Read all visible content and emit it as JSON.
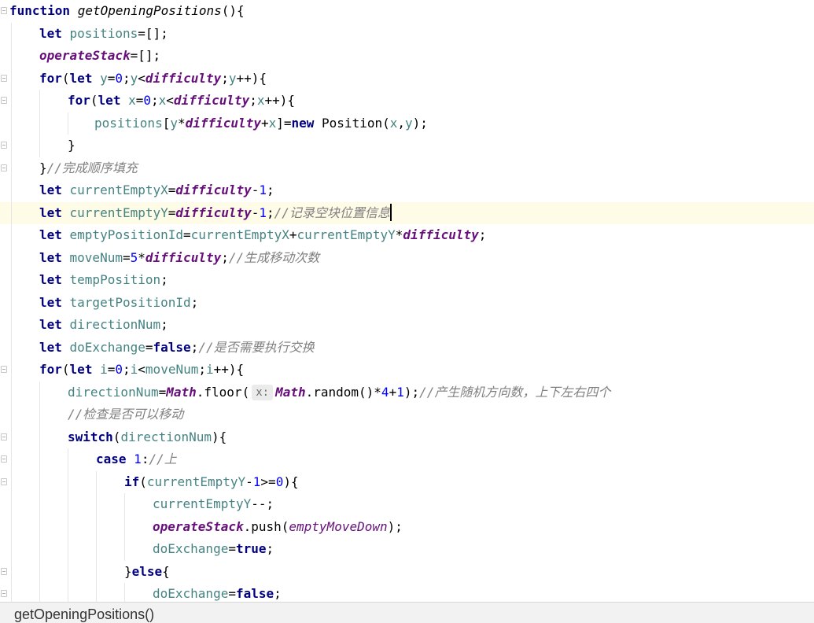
{
  "editor": {
    "lines": [
      {
        "segments": [
          {
            "t": "function ",
            "c": "kw"
          },
          {
            "t": "getOpeningPositions",
            "c": "fn"
          },
          {
            "t": "(){",
            "c": ""
          }
        ]
      },
      {
        "segments": [
          {
            "t": "let ",
            "c": "kw"
          },
          {
            "t": "positions",
            "c": "var"
          },
          {
            "t": "=[];",
            "c": ""
          }
        ]
      },
      {
        "segments": [
          {
            "t": "operateStack",
            "c": "gl"
          },
          {
            "t": "=[];",
            "c": ""
          }
        ]
      },
      {
        "segments": [
          {
            "t": "for",
            "c": "kw"
          },
          {
            "t": "(",
            "c": ""
          },
          {
            "t": "let ",
            "c": "kw"
          },
          {
            "t": "y",
            "c": "var"
          },
          {
            "t": "=",
            "c": ""
          },
          {
            "t": "0",
            "c": "num"
          },
          {
            "t": ";",
            "c": ""
          },
          {
            "t": "y",
            "c": "var"
          },
          {
            "t": "<",
            "c": ""
          },
          {
            "t": "difficulty",
            "c": "gl"
          },
          {
            "t": ";",
            "c": ""
          },
          {
            "t": "y",
            "c": "var"
          },
          {
            "t": "++){",
            "c": ""
          }
        ]
      },
      {
        "segments": [
          {
            "t": "for",
            "c": "kw"
          },
          {
            "t": "(",
            "c": ""
          },
          {
            "t": "let ",
            "c": "kw"
          },
          {
            "t": "x",
            "c": "var"
          },
          {
            "t": "=",
            "c": ""
          },
          {
            "t": "0",
            "c": "num"
          },
          {
            "t": ";",
            "c": ""
          },
          {
            "t": "x",
            "c": "var"
          },
          {
            "t": "<",
            "c": ""
          },
          {
            "t": "difficulty",
            "c": "gl"
          },
          {
            "t": ";",
            "c": ""
          },
          {
            "t": "x",
            "c": "var"
          },
          {
            "t": "++){",
            "c": ""
          }
        ]
      },
      {
        "segments": [
          {
            "t": "positions",
            "c": "var"
          },
          {
            "t": "[",
            "c": ""
          },
          {
            "t": "y",
            "c": "var"
          },
          {
            "t": "*",
            "c": ""
          },
          {
            "t": "difficulty",
            "c": "gl"
          },
          {
            "t": "+",
            "c": ""
          },
          {
            "t": "x",
            "c": "var"
          },
          {
            "t": "]=",
            "c": ""
          },
          {
            "t": "new ",
            "c": "kw"
          },
          {
            "t": "Position(",
            "c": ""
          },
          {
            "t": "x",
            "c": "var"
          },
          {
            "t": ",",
            "c": ""
          },
          {
            "t": "y",
            "c": "var"
          },
          {
            "t": ");",
            "c": ""
          }
        ]
      },
      {
        "segments": [
          {
            "t": "}",
            "c": ""
          }
        ]
      },
      {
        "segments": [
          {
            "t": "}",
            "c": ""
          },
          {
            "t": "//完成顺序填充",
            "c": "cm"
          }
        ]
      },
      {
        "segments": [
          {
            "t": "let ",
            "c": "kw"
          },
          {
            "t": "currentEmptyX",
            "c": "var"
          },
          {
            "t": "=",
            "c": ""
          },
          {
            "t": "difficulty",
            "c": "gl"
          },
          {
            "t": "-",
            "c": ""
          },
          {
            "t": "1",
            "c": "num"
          },
          {
            "t": ";",
            "c": ""
          }
        ]
      },
      {
        "segments": [
          {
            "t": "let ",
            "c": "kw"
          },
          {
            "t": "currentEmptyY",
            "c": "var"
          },
          {
            "t": "=",
            "c": ""
          },
          {
            "t": "difficulty",
            "c": "gl"
          },
          {
            "t": "-",
            "c": ""
          },
          {
            "t": "1",
            "c": "num"
          },
          {
            "t": ";",
            "c": ""
          },
          {
            "t": "//记录空块位置信息",
            "c": "cm"
          }
        ]
      },
      {
        "segments": [
          {
            "t": "let ",
            "c": "kw"
          },
          {
            "t": "emptyPositionId",
            "c": "var"
          },
          {
            "t": "=",
            "c": ""
          },
          {
            "t": "currentEmptyX",
            "c": "var"
          },
          {
            "t": "+",
            "c": ""
          },
          {
            "t": "currentEmptyY",
            "c": "var"
          },
          {
            "t": "*",
            "c": ""
          },
          {
            "t": "difficulty",
            "c": "gl"
          },
          {
            "t": ";",
            "c": ""
          }
        ]
      },
      {
        "segments": [
          {
            "t": "let ",
            "c": "kw"
          },
          {
            "t": "moveNum",
            "c": "var"
          },
          {
            "t": "=",
            "c": ""
          },
          {
            "t": "5",
            "c": "num"
          },
          {
            "t": "*",
            "c": ""
          },
          {
            "t": "difficulty",
            "c": "gl"
          },
          {
            "t": ";",
            "c": ""
          },
          {
            "t": "//生成移动次数",
            "c": "cm"
          }
        ]
      },
      {
        "segments": [
          {
            "t": "let ",
            "c": "kw"
          },
          {
            "t": "tempPosition",
            "c": "var"
          },
          {
            "t": ";",
            "c": ""
          }
        ]
      },
      {
        "segments": [
          {
            "t": "let ",
            "c": "kw"
          },
          {
            "t": "targetPositionId",
            "c": "var"
          },
          {
            "t": ";",
            "c": ""
          }
        ]
      },
      {
        "segments": [
          {
            "t": "let ",
            "c": "kw"
          },
          {
            "t": "directionNum",
            "c": "var"
          },
          {
            "t": ";",
            "c": ""
          }
        ]
      },
      {
        "segments": [
          {
            "t": "let ",
            "c": "kw"
          },
          {
            "t": "doExchange",
            "c": "var"
          },
          {
            "t": "=",
            "c": ""
          },
          {
            "t": "false",
            "c": "kw"
          },
          {
            "t": ";",
            "c": ""
          },
          {
            "t": "//是否需要执行交换",
            "c": "cm"
          }
        ]
      },
      {
        "segments": [
          {
            "t": "for",
            "c": "kw"
          },
          {
            "t": "(",
            "c": ""
          },
          {
            "t": "let ",
            "c": "kw"
          },
          {
            "t": "i",
            "c": "var"
          },
          {
            "t": "=",
            "c": ""
          },
          {
            "t": "0",
            "c": "num"
          },
          {
            "t": ";",
            "c": ""
          },
          {
            "t": "i",
            "c": "var"
          },
          {
            "t": "<",
            "c": ""
          },
          {
            "t": "moveNum",
            "c": "var"
          },
          {
            "t": ";",
            "c": ""
          },
          {
            "t": "i",
            "c": "var"
          },
          {
            "t": "++){",
            "c": ""
          }
        ]
      },
      {
        "segments": [
          {
            "t": "directionNum",
            "c": "var"
          },
          {
            "t": "=",
            "c": ""
          },
          {
            "t": "Math",
            "c": "gl"
          },
          {
            "t": ".floor(",
            "c": ""
          },
          {
            "t": "x:",
            "c": "hint"
          },
          {
            "t": "Math",
            "c": "gl"
          },
          {
            "t": ".random()*",
            "c": ""
          },
          {
            "t": "4",
            "c": "num"
          },
          {
            "t": "+",
            "c": ""
          },
          {
            "t": "1",
            "c": "num"
          },
          {
            "t": ");",
            "c": ""
          },
          {
            "t": "//产生随机方向数，上下左右四个",
            "c": "cm"
          }
        ]
      },
      {
        "segments": [
          {
            "t": "//检查是否可以移动",
            "c": "cm"
          }
        ]
      },
      {
        "segments": [
          {
            "t": "switch",
            "c": "kw"
          },
          {
            "t": "(",
            "c": ""
          },
          {
            "t": "directionNum",
            "c": "var"
          },
          {
            "t": "){",
            "c": ""
          }
        ]
      },
      {
        "segments": [
          {
            "t": "case ",
            "c": "kw"
          },
          {
            "t": "1",
            "c": "num"
          },
          {
            "t": ":",
            "c": ""
          },
          {
            "t": "//上",
            "c": "cm"
          }
        ]
      },
      {
        "segments": [
          {
            "t": "if",
            "c": "kw"
          },
          {
            "t": "(",
            "c": ""
          },
          {
            "t": "currentEmptyY",
            "c": "var"
          },
          {
            "t": "-",
            "c": ""
          },
          {
            "t": "1",
            "c": "num"
          },
          {
            "t": ">=",
            "c": ""
          },
          {
            "t": "0",
            "c": "num"
          },
          {
            "t": "){",
            "c": ""
          }
        ]
      },
      {
        "segments": [
          {
            "t": "currentEmptyY",
            "c": "var"
          },
          {
            "t": "--;",
            "c": ""
          }
        ]
      },
      {
        "segments": [
          {
            "t": "operateStack",
            "c": "gl"
          },
          {
            "t": ".push(",
            "c": ""
          },
          {
            "t": "emptyMoveDown",
            "c": "gl2"
          },
          {
            "t": ");",
            "c": ""
          }
        ]
      },
      {
        "segments": [
          {
            "t": "doExchange",
            "c": "var"
          },
          {
            "t": "=",
            "c": ""
          },
          {
            "t": "true",
            "c": "kw"
          },
          {
            "t": ";",
            "c": ""
          }
        ]
      },
      {
        "segments": [
          {
            "t": "}",
            "c": ""
          },
          {
            "t": "else",
            "c": "kw"
          },
          {
            "t": "{",
            "c": ""
          }
        ]
      },
      {
        "segments": [
          {
            "t": "doExchange",
            "c": "var"
          },
          {
            "t": "=",
            "c": ""
          },
          {
            "t": "false",
            "c": "kw"
          },
          {
            "t": ";",
            "c": ""
          }
        ]
      }
    ]
  },
  "statusbar": {
    "breadcrumb": "getOpeningPositions()"
  }
}
